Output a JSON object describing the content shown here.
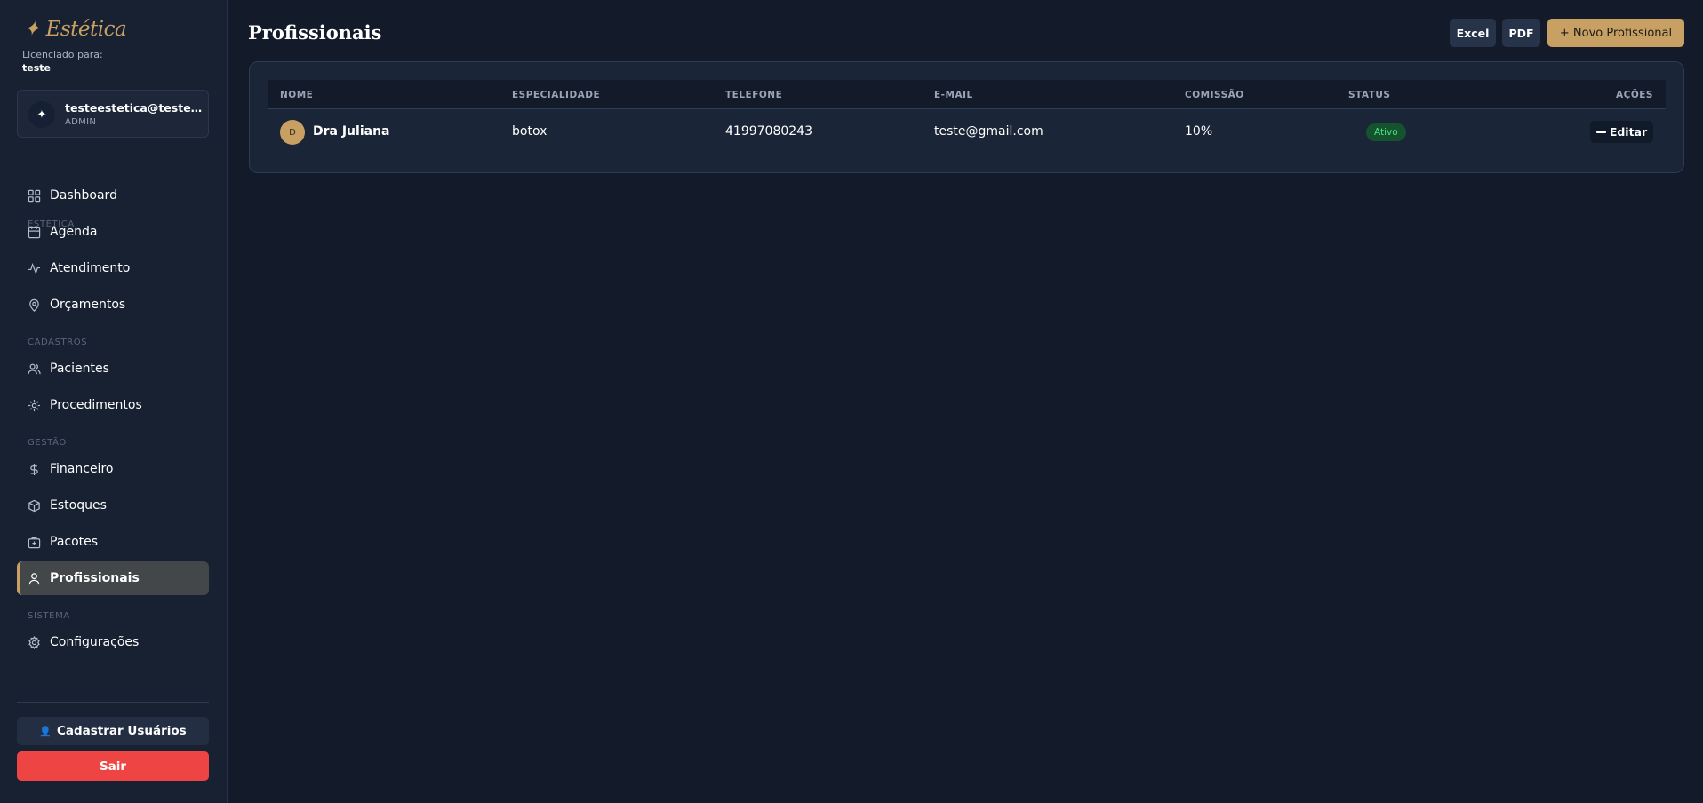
{
  "brand": {
    "logo": "✦ Estética",
    "licensed_label": "Licenciado para:",
    "licensed_name": "teste"
  },
  "user": {
    "avatar": "✦",
    "email": "testeestetica@teste.com",
    "role": "ADMIN"
  },
  "sidebar": {
    "sections": [
      {
        "label": "ESTÉTICA"
      },
      {
        "label": "CADASTROS"
      },
      {
        "label": "GESTÃO"
      },
      {
        "label": "SISTEMA"
      }
    ],
    "items": [
      {
        "label": "Dashboard",
        "icon": "grid-icon"
      },
      {
        "label": "Agenda",
        "icon": "calendar-icon"
      },
      {
        "label": "Atendimento",
        "icon": "activity-icon"
      },
      {
        "label": "Orçamentos",
        "icon": "map-pin-icon"
      },
      {
        "label": "Pacientes",
        "icon": "users-icon"
      },
      {
        "label": "Procedimentos",
        "icon": "sparkle-icon"
      },
      {
        "label": "Financeiro",
        "icon": "dollar-icon"
      },
      {
        "label": "Estoques",
        "icon": "box-icon"
      },
      {
        "label": "Pacotes",
        "icon": "package-icon"
      },
      {
        "label": "Profissionais",
        "icon": "user-icon",
        "active": true
      },
      {
        "label": "Configurações",
        "icon": "gear-icon"
      }
    ],
    "register_users": "Cadastrar Usuários",
    "register_emoji": "👤",
    "logout": "Sair"
  },
  "header": {
    "title": "Profissionais",
    "excel": "Excel",
    "pdf": "PDF",
    "new_professional": "+ Novo Profissional"
  },
  "table": {
    "columns": [
      "NOME",
      "ESPECIALIDADE",
      "TELEFONE",
      "E-MAIL",
      "COMISSÃO",
      "STATUS",
      "AÇÕES"
    ],
    "rows": [
      {
        "avatar": "D",
        "name": "Dra Juliana",
        "specialty": "botox",
        "phone": "41997080243",
        "email": "teste@gmail.com",
        "commission": "10%",
        "status": "Ativo",
        "action": "Editar"
      }
    ]
  },
  "colors": {
    "accent": "#c9a063",
    "background": "#131a2a",
    "sidebar": "#172132",
    "danger": "#ef4444",
    "status_active_bg": "#14532d",
    "status_active_text": "#4ade80"
  }
}
